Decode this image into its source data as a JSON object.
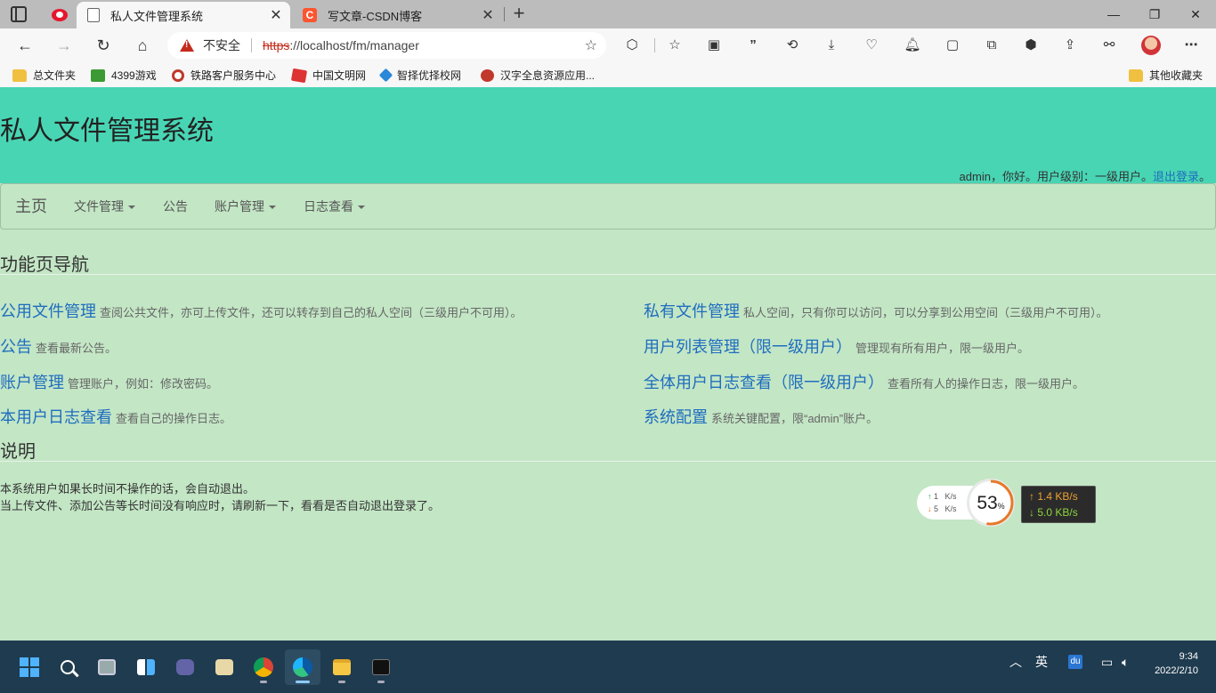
{
  "browser": {
    "tabs": [
      {
        "title": "私人文件管理系统",
        "active": true
      },
      {
        "title": "写文章-CSDN博客",
        "active": false
      }
    ],
    "address": {
      "security_label": "不安全",
      "url_scheme": "https",
      "url_rest": "://localhost/fm/manager"
    },
    "bookmarks": [
      {
        "label": "总文件夹",
        "icon": "folder-icon"
      },
      {
        "label": "4399游戏",
        "icon": "4399-icon"
      },
      {
        "label": "铁路客户服务中心",
        "icon": "railway-icon"
      },
      {
        "label": "中国文明网",
        "icon": "wenming-icon"
      },
      {
        "label": "智择优择校网",
        "icon": "school-icon"
      },
      {
        "label": "汉字全息资源应用...",
        "icon": "hanzi-icon"
      }
    ],
    "other_bookmarks": "其他收藏夹"
  },
  "header": {
    "title": "私人文件管理系统",
    "user_text": "admin，你好。用户级别：一级用户。",
    "logout_label": "退出登录",
    "logout_suffix": "。"
  },
  "nav": {
    "brand": "主页",
    "items": [
      "文件管理",
      "公告",
      "账户管理",
      "日志查看"
    ]
  },
  "main": {
    "nav_heading": "功能页导航",
    "links_left": [
      {
        "title": "公用文件管理",
        "desc": "查阅公共文件，亦可上传文件，还可以转存到自己的私人空间（三级用户不可用）。"
      },
      {
        "title": "公告",
        "desc": "查看最新公告。"
      },
      {
        "title": "账户管理",
        "desc": "管理账户，例如：修改密码。"
      },
      {
        "title": "本用户日志查看",
        "desc": "查看自己的操作日志。"
      }
    ],
    "links_right": [
      {
        "title": "私有文件管理",
        "desc": "私人空间，只有你可以访问，可以分享到公用空间（三级用户不可用）。"
      },
      {
        "title": "用户列表管理（限一级用户）",
        "desc": "管理现有所有用户，限一级用户。"
      },
      {
        "title": "全体用户日志查看（限一级用户）",
        "desc": "查看所有人的操作日志，限一级用户。"
      },
      {
        "title": "系统配置",
        "desc": "系统关键配置，限“admin”账户。"
      }
    ],
    "notes_heading": "说明",
    "notes": [
      "本系统用户如果长时间不操作的话，会自动退出。",
      "当上传文件、添加公告等长时间没有响应时，请刷新一下，看看是否自动退出登录了。"
    ]
  },
  "widget": {
    "up_speed": "1",
    "down_speed": "5",
    "unit": "K/s",
    "percent": "53",
    "percent_sign": "%",
    "percent_value": 0.53,
    "net_up": "1.4 KB/s",
    "net_down": "5.0 KB/s",
    "ring_color": "#e8782a"
  },
  "taskbar": {
    "ime": "英",
    "time": "9:34",
    "date": "2022/2/10"
  }
}
